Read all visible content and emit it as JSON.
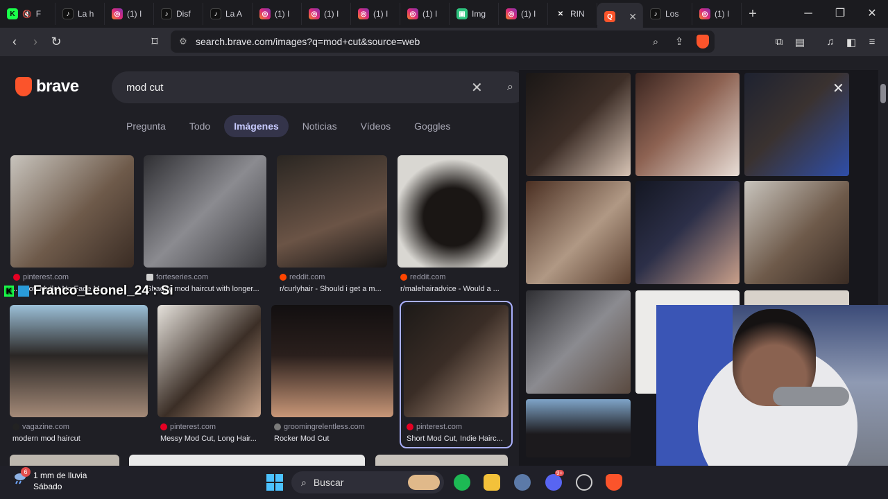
{
  "tabs": [
    {
      "label": "F",
      "icon": "kick-icon"
    },
    {
      "label": "La h",
      "icon": "tiktok-icon"
    },
    {
      "label": "(1) I",
      "icon": "instagram-icon"
    },
    {
      "label": "Disf",
      "icon": "tiktok-icon"
    },
    {
      "label": "La A",
      "icon": "tiktok-icon"
    },
    {
      "label": "(1) I",
      "icon": "instagram-icon"
    },
    {
      "label": "(1) I",
      "icon": "instagram-icon"
    },
    {
      "label": "(1) I",
      "icon": "instagram-icon"
    },
    {
      "label": "(1) I",
      "icon": "instagram-icon"
    },
    {
      "label": "Img",
      "icon": "image-icon"
    },
    {
      "label": "(1) I",
      "icon": "instagram-icon"
    },
    {
      "label": "RIN",
      "icon": "rin-icon"
    },
    {
      "label": "",
      "icon": "brave-icon",
      "active": true
    },
    {
      "label": "Los",
      "icon": "tiktok-icon"
    },
    {
      "label": "(1) I",
      "icon": "instagram-icon"
    }
  ],
  "address": {
    "url": "search.brave.com/images?q=mod+cut&source=web"
  },
  "brand": {
    "name": "brave"
  },
  "search": {
    "query": "mod cut"
  },
  "nav_tabs": [
    {
      "label": "Pregunta"
    },
    {
      "label": "Todo"
    },
    {
      "label": "Imágenes",
      "active": true
    },
    {
      "label": "Noticias"
    },
    {
      "label": "Vídeos"
    },
    {
      "label": "Goggles"
    }
  ],
  "results": [
    {
      "source": "pinterest.com",
      "caption": "...t Soft Mullet No Fade M...",
      "src_color": "#e60023"
    },
    {
      "source": "forteseries.com",
      "caption": "Shaggy mod haircut with longer...",
      "src_color": "#cfcfcf"
    },
    {
      "source": "reddit.com",
      "caption": "r/curlyhair - Should i get a m...",
      "src_color": "#ff4500"
    },
    {
      "source": "reddit.com",
      "caption": "r/malehairadvice - Would a ...",
      "src_color": "#ff4500"
    },
    {
      "source": "vagazine.com",
      "caption": "modern mod haircut",
      "src_color": "#222222"
    },
    {
      "source": "pinterest.com",
      "caption": "Messy Mod Cut, Long Hair...",
      "src_color": "#e60023"
    },
    {
      "source": "groomingrelentless.com",
      "caption": "Rocker Mod Cut",
      "src_color": "#7a7a7a"
    },
    {
      "source": "pinterest.com",
      "caption": "Short Mod Cut, Indie Hairc...",
      "src_color": "#e60023"
    }
  ],
  "overlay": {
    "username": "Franco_Leonel_24 : Si"
  },
  "taskbar": {
    "weather_badge": "6",
    "weather_line1": "1 mm de lluvia",
    "weather_line2": "Sábado",
    "search_label": "Buscar",
    "discord_badge": "9+"
  }
}
